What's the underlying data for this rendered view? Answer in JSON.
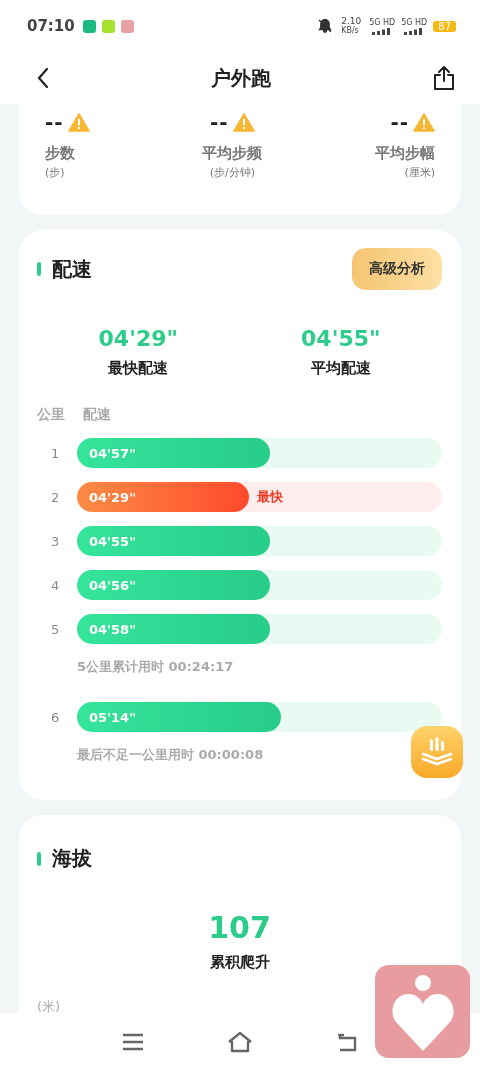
{
  "status_bar": {
    "time": "07:10",
    "net_speed": "2.10",
    "net_unit": "KB/s",
    "sim_labels": [
      "5G HD",
      "5G HD"
    ],
    "battery": "87"
  },
  "header": {
    "title": "户外跑"
  },
  "metrics": [
    {
      "value": "--",
      "label": "步数",
      "unit": "(步)"
    },
    {
      "value": "--",
      "label": "平均步频",
      "unit": "(步/分钟)"
    },
    {
      "value": "--",
      "label": "平均步幅",
      "unit": "(厘米)"
    }
  ],
  "pace": {
    "title": "配速",
    "button": "高级分析",
    "stats": [
      {
        "value": "04'29\"",
        "label": "最快配速"
      },
      {
        "value": "04'55\"",
        "label": "平均配速"
      }
    ],
    "columns": [
      "公里",
      "配速"
    ],
    "rows": [
      {
        "km": "1",
        "pace": "04'57\"",
        "level": 0.53,
        "fastest": false
      },
      {
        "km": "2",
        "pace": "04'29\"",
        "level": 0.47,
        "fastest": true,
        "badge": "最快"
      },
      {
        "km": "3",
        "pace": "04'55\"",
        "level": 0.53,
        "fastest": false
      },
      {
        "km": "4",
        "pace": "04'56\"",
        "level": 0.53,
        "fastest": false
      },
      {
        "km": "5",
        "pace": "04'58\"",
        "level": 0.53,
        "fastest": false,
        "note": "5公里累计用时 00:24:17"
      },
      {
        "km": "6",
        "pace": "05'14\"",
        "level": 0.56,
        "fastest": false,
        "note": "最后不足一公里用时 00:00:08"
      }
    ]
  },
  "altitude": {
    "title": "海拔",
    "value": "107",
    "label": "累积爬升",
    "unit": "(米)"
  }
}
